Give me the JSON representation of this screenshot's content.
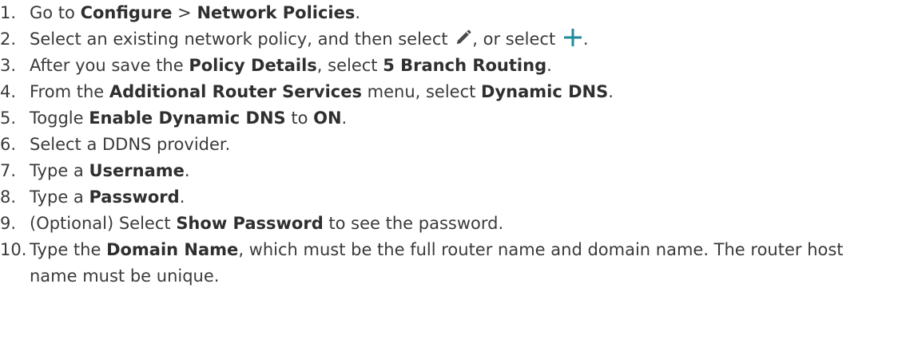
{
  "steps": [
    {
      "num": "1.",
      "parts": [
        "Go to ",
        "Configure",
        " > ",
        "Network Policies",
        "."
      ]
    },
    {
      "num": "2.",
      "parts": [
        "Select an existing network policy, and then select ",
        ", or select ",
        "."
      ],
      "icons": [
        "pencil-icon",
        "plus-icon"
      ]
    },
    {
      "num": "3.",
      "parts": [
        "After you save the ",
        "Policy Details",
        ", select ",
        "5 Branch Routing",
        "."
      ]
    },
    {
      "num": "4.",
      "parts": [
        "From the ",
        "Additional Router Services",
        " menu, select ",
        "Dynamic DNS",
        "."
      ]
    },
    {
      "num": "5.",
      "parts": [
        "Toggle ",
        "Enable Dynamic DNS",
        " to ",
        "ON",
        "."
      ]
    },
    {
      "num": "6.",
      "parts": [
        "Select a DDNS provider."
      ]
    },
    {
      "num": "7.",
      "parts": [
        "Type a ",
        "Username",
        "."
      ]
    },
    {
      "num": "8.",
      "parts": [
        "Type a ",
        "Password",
        "."
      ]
    },
    {
      "num": "9.",
      "parts": [
        "(Optional) Select ",
        "Show Password",
        " to see the password."
      ]
    },
    {
      "num": "10.",
      "parts": [
        "Type the ",
        "Domain Name",
        ", which must be the full router name and domain name. The router host name must be unique."
      ]
    }
  ],
  "colors": {
    "text": "#3a3a3a",
    "icon_pencil": "#4a4a4a",
    "icon_plus": "#1f8a9e"
  }
}
